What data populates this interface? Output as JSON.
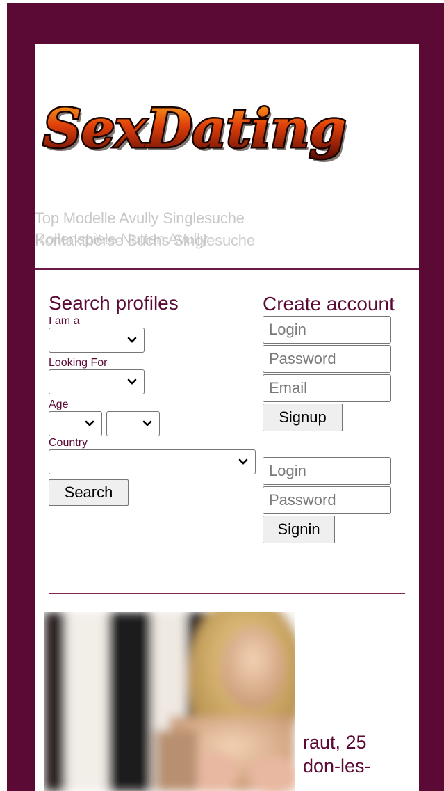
{
  "brand": {
    "logo_text": "SexDating"
  },
  "header": {
    "tagline_1": "Top Modelle Avully Singlesuche",
    "tagline_2": "Rollenspiele Nutten Avully",
    "tagline_3": "Kontaktbörse Buchs Singlesuche"
  },
  "search": {
    "title": "Search profiles",
    "i_am_label": "I am a",
    "looking_for_label": "Looking For",
    "age_label": "Age",
    "country_label": "Country",
    "search_button": "Search"
  },
  "account": {
    "title": "Create account",
    "signup_login_placeholder": "Login",
    "signup_password_placeholder": "Password",
    "signup_email_placeholder": "Email",
    "signup_button": "Signup",
    "signin_login_placeholder": "Login",
    "signin_password_placeholder": "Password",
    "signin_button": "Signin"
  },
  "profile": {
    "line_1": "raut, 25",
    "line_2": "don-les-"
  },
  "colors": {
    "frame": "#5a0a35",
    "accent_text": "#5a0a35",
    "panel": "#ffffff"
  }
}
